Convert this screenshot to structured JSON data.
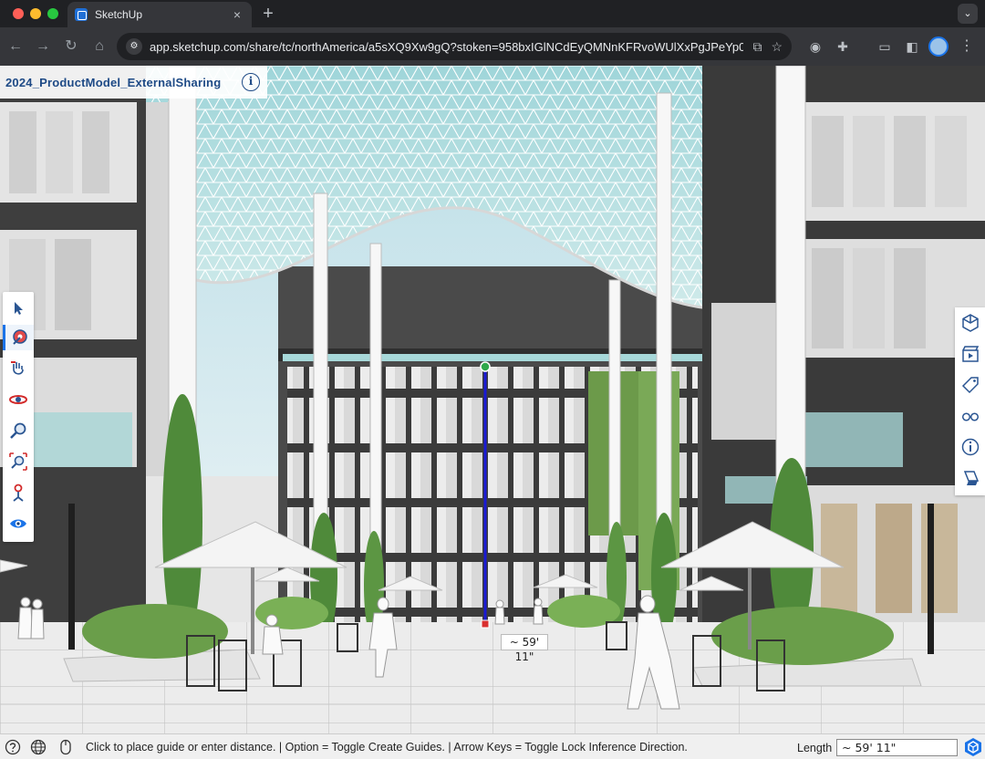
{
  "browser": {
    "tab_title": "SketchUp",
    "tab_close": "×",
    "new_tab": "+",
    "url": "app.sketchup.com/share/tc/northAmerica/a5sXQ9Xw9gQ?stoken=958bxIGlNCdEyQMNnKFRvoWUlXxPgJPeYp0l...",
    "nav": {
      "back": "←",
      "forward": "→",
      "reload": "↻",
      "home": "⌂"
    }
  },
  "model": {
    "title": "2024_ProductModel_ExternalSharing",
    "info_glyph": "i"
  },
  "left_toolbar": {
    "tools": [
      {
        "name": "select-tool-icon"
      },
      {
        "name": "tape-measure-tool-icon",
        "active": true
      },
      {
        "name": "pan-tool-icon"
      },
      {
        "name": "orbit-tool-icon"
      },
      {
        "name": "zoom-tool-icon"
      },
      {
        "name": "zoom-extents-tool-icon"
      },
      {
        "name": "position-camera-tool-icon"
      },
      {
        "name": "look-around-tool-icon"
      }
    ]
  },
  "right_toolbar": {
    "tools": [
      {
        "name": "views-panel-icon"
      },
      {
        "name": "scenes-panel-icon"
      },
      {
        "name": "tags-panel-icon"
      },
      {
        "name": "display-panel-icon"
      },
      {
        "name": "entity-info-panel-icon"
      },
      {
        "name": "styles-panel-icon"
      }
    ]
  },
  "measurement": {
    "tag": "~ 59' 11\""
  },
  "status_bar": {
    "hint": "Click to place guide or enter distance. | Option = Toggle Create Guides. | Arrow Keys = Toggle Lock Inference Direction.",
    "length_label": "Length",
    "length_value": "~ 59' 11\""
  },
  "colors": {
    "accent": "#1a73e8",
    "title_blue": "#1e4a86",
    "measure_line": "#1a1ad6",
    "tool_red": "#d22b2b"
  }
}
